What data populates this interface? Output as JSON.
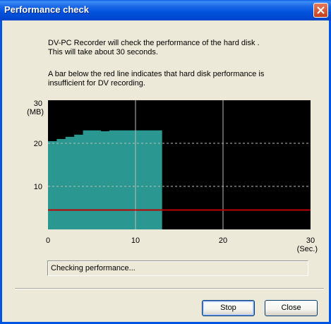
{
  "window": {
    "title": "Performance check"
  },
  "message": {
    "line1": "DV-PC Recorder will check the performance of the hard disk .",
    "line2": "This will take about 30 seconds.",
    "line3": "A bar below the red line indicates that hard disk performance is",
    "line4": "insufficient for DV recording."
  },
  "chart": {
    "y_top_label": "30",
    "y_unit": "(MB)",
    "y_tick_20": "20",
    "y_tick_10": "10",
    "x_tick_0": "0",
    "x_tick_10": "10",
    "x_tick_20": "20",
    "x_tick_30": "30",
    "x_unit": "(Sec.)"
  },
  "chart_data": {
    "type": "area",
    "x": [
      0,
      1,
      2,
      3,
      4,
      5,
      6,
      7,
      8,
      9,
      10,
      11,
      12,
      13
    ],
    "y": [
      20.5,
      21,
      21.5,
      22,
      23,
      23,
      22.8,
      23,
      23,
      23,
      23,
      23,
      23,
      23
    ],
    "threshold": 4.5,
    "xlim": [
      0,
      30
    ],
    "ylim": [
      0,
      30
    ],
    "x_gridlines": [
      10,
      20
    ],
    "y_gridlines": [
      10,
      20
    ],
    "colors": {
      "background": "#000000",
      "fill": "#2A9890",
      "threshold": "#C00000",
      "grid": "#bbbbbb"
    }
  },
  "status": {
    "text": "Checking performance..."
  },
  "buttons": {
    "stop": "Stop",
    "close": "Close"
  }
}
